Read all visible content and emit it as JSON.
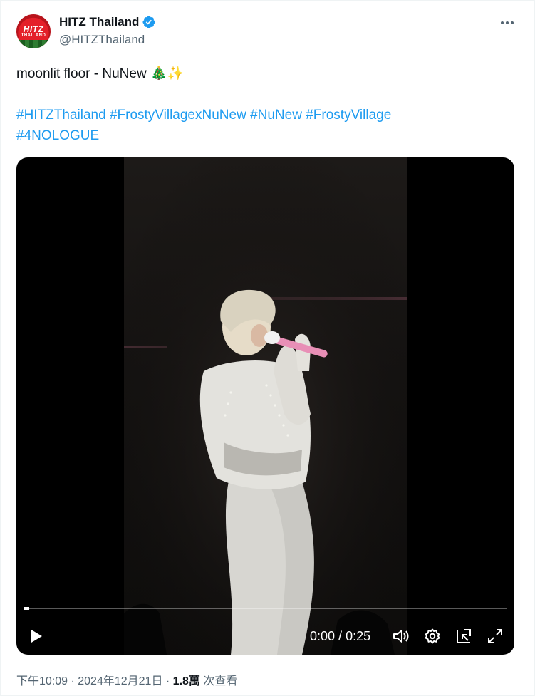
{
  "account": {
    "display_name": "HITZ Thailand",
    "handle": "@HITZThailand",
    "avatar_text": "HITZ",
    "avatar_subtext": "THAILAND"
  },
  "tweet": {
    "text": "moonlit floor - NuNew 🎄✨",
    "hashtags": [
      "#HITZThailand",
      "#FrostyVillagexNuNew",
      "#NuNew",
      " #FrostyVillage",
      "#4NOLOGUE"
    ]
  },
  "video": {
    "time_current": "0:00",
    "time_separator": " / ",
    "time_total": "0:25",
    "progress_fraction": 0.01
  },
  "footer": {
    "timestamp": "下午10:09 · 2024年12月21日 · ",
    "views_count": "1.8萬",
    "views_label": " 次查看"
  },
  "colors": {
    "link": "#1d9bf0",
    "verified": "#1d9bf0",
    "secondary_text": "#536471"
  },
  "icons": [
    "more-icon",
    "verified-badge-icon",
    "play-icon",
    "volume-icon",
    "settings-icon",
    "pip-icon",
    "fullscreen-icon"
  ]
}
